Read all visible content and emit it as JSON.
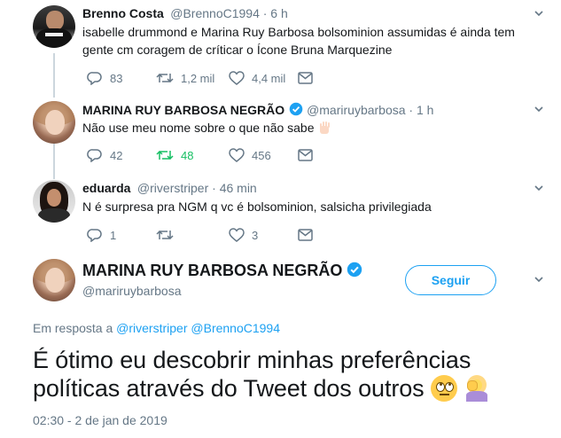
{
  "tweets": [
    {
      "name": "Brenno Costa",
      "handle": "@BrennoC1994 · 6 h",
      "text_line1": "isabelle drummond e Marina Ruy Barbosa bolsominion assumidas é ainda tem",
      "text_line2": "gente cm coragem de críticar o Ícone Bruna Marquezine",
      "replies": "83",
      "retweets": "1,2 mil",
      "likes": "4,4 mil"
    },
    {
      "name": "MARINA RUY BARBOSA NEGRÃO",
      "handle": "@mariruybarbosa · 1 h",
      "text": "Não use meu nome sobre o que não sabe",
      "replies": "42",
      "retweets": "48",
      "likes": "456"
    },
    {
      "name": "eduarda",
      "handle": "@riverstriper · 46 min",
      "text": "N é surpresa pra NGM q vc é bolsominion, salsicha privilegiada",
      "replies": "1",
      "retweets": "",
      "likes": "3"
    }
  ],
  "main_tweet": {
    "name": "MARINA RUY BARBOSA NEGRÃO",
    "handle": "@mariruybarbosa",
    "follow_label": "Seguir",
    "reply_prefix": "Em resposta a",
    "reply_mention_1": "@riverstriper",
    "reply_mention_2": "@BrennoC1994",
    "text_line1": "É ótimo eu descobrir minhas preferências",
    "text_line2": "políticas através do Tweet dos outros",
    "timestamp": "02:30 - 2 de jan de 2019"
  },
  "colors": {
    "accent": "#1da1f2",
    "retweet_active": "#17bf63",
    "muted": "#657786",
    "verified": "#1da1f2"
  },
  "icons": [
    "reply-icon",
    "retweet-icon",
    "like-icon",
    "dm-icon",
    "chevron-down-icon",
    "verified-badge-icon",
    "raised-hand-emoji",
    "eye-roll-emoji",
    "facepalm-emoji"
  ]
}
